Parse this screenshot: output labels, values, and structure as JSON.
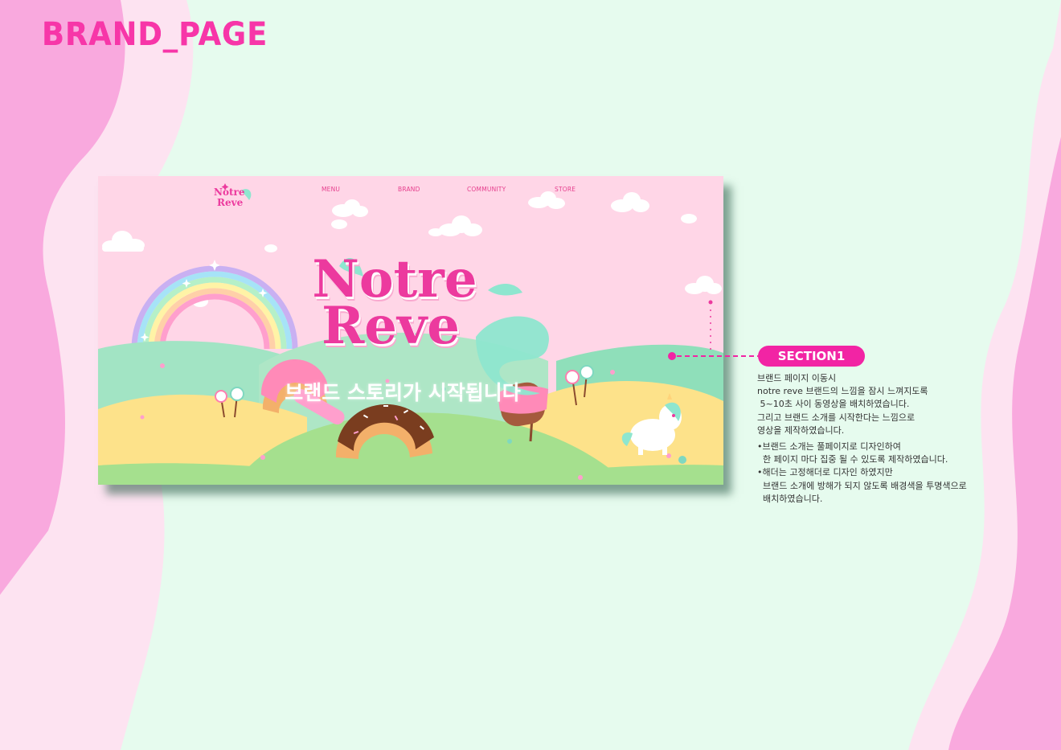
{
  "page": {
    "heading": "BRAND_PAGE"
  },
  "colors": {
    "background": "#e6fbee",
    "accent_pink": "#f224a4",
    "heading_pink": "#f736a8",
    "mockup_sky": "#ffd6e7"
  },
  "mockup": {
    "nav": {
      "logo_line1": "Notre",
      "logo_line2": "Reve",
      "items": [
        "MENU",
        "BRAND",
        "COMMUNITY",
        "STORE"
      ]
    },
    "hero": {
      "title_line1": "Notre",
      "title_line2": "Reve",
      "subtitle": "브랜드 스토리가 시작됩니다"
    }
  },
  "annotation": {
    "badge": "SECTION1",
    "lines": [
      "브랜드 페이지 이동시",
      "notre reve 브랜드의 느낌을 잠시 느껴지도록",
      " 5~10초 사이 동영상을 배치하였습니다.",
      "그리고 브랜드 소개를 시작한다는 느낌으로",
      "영상을 제작하였습니다."
    ],
    "bullets": [
      "•브랜드 소개는 풀페이지로 디자인하여",
      "  한 페이지 마다 집중 될 수 있도록 제작하였습니다.",
      "•해더는 고정해더로 디자인 하였지만",
      "  브랜드 소개에 방해가 되지 않도록 배경색을 투명색으로",
      "  배치하였습니다."
    ]
  }
}
